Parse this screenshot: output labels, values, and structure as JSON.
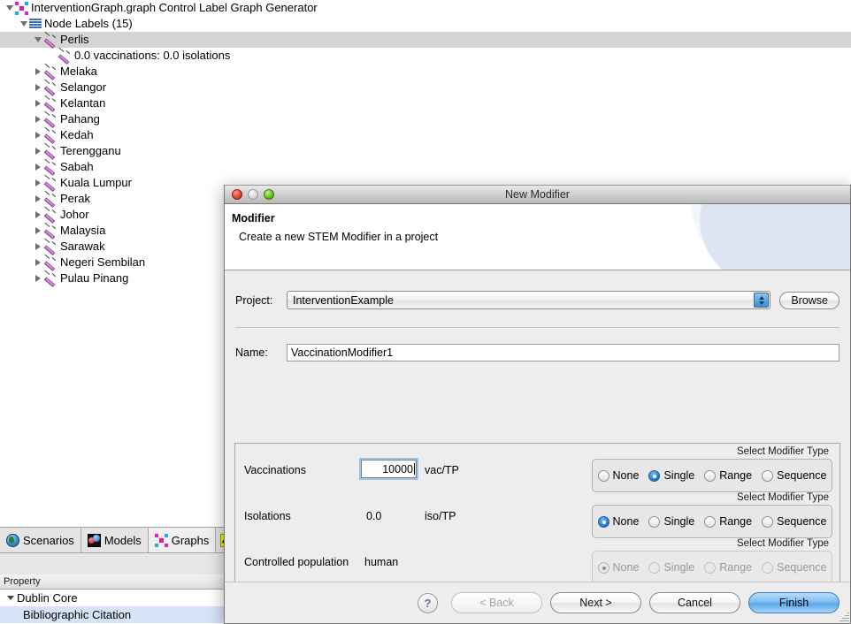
{
  "workbench": {
    "tree": {
      "root": {
        "label": "InterventionGraph.graph Control Label Graph Generator",
        "icon": "graph-icon",
        "expanded": true
      },
      "group": {
        "label": "Node Labels (15)",
        "icon": "node-labels-icon",
        "expanded": true
      },
      "selected_node": {
        "label": "Perlis",
        "icon": "syringe-icon",
        "expanded": true
      },
      "selected_child": {
        "label": "0.0 vaccinations: 0.0 isolations",
        "icon": "syringe-icon"
      },
      "nodes": [
        {
          "label": "Melaka",
          "icon": "syringe-icon"
        },
        {
          "label": "Selangor",
          "icon": "syringe-icon"
        },
        {
          "label": "Kelantan",
          "icon": "syringe-icon"
        },
        {
          "label": "Pahang",
          "icon": "syringe-icon"
        },
        {
          "label": "Kedah",
          "icon": "syringe-icon"
        },
        {
          "label": "Terengganu",
          "icon": "syringe-icon"
        },
        {
          "label": "Sabah",
          "icon": "syringe-icon"
        },
        {
          "label": "Kuala Lumpur",
          "icon": "syringe-icon"
        },
        {
          "label": "Perak",
          "icon": "syringe-icon"
        },
        {
          "label": "Johor",
          "icon": "syringe-icon"
        },
        {
          "label": "Malaysia",
          "icon": "syringe-icon"
        },
        {
          "label": "Sarawak",
          "icon": "syringe-icon"
        },
        {
          "label": "Negeri Sembilan",
          "icon": "syringe-icon"
        },
        {
          "label": "Pulau Pinang",
          "icon": "syringe-icon"
        }
      ]
    },
    "tabs": [
      {
        "label": "Scenarios",
        "icon": "globe-icon",
        "active": false
      },
      {
        "label": "Models",
        "icon": "models-icon",
        "active": false
      },
      {
        "label": "Graphs",
        "icon": "graph-icon",
        "active": true
      },
      {
        "label": "",
        "icon": "yellow-edge-icon",
        "active": false
      }
    ],
    "properties": {
      "header": "Property",
      "rows": [
        {
          "label": "Dublin Core",
          "expanded": true,
          "highlighted": false
        },
        {
          "label": "Bibliographic Citation",
          "expanded": false,
          "highlighted": true
        }
      ]
    }
  },
  "dialog": {
    "title": "New Modifier",
    "banner": {
      "heading": "Modifier",
      "subheading": "Create a new STEM Modifier in a project"
    },
    "project": {
      "label": "Project:",
      "value": "InterventionExample",
      "browse_label": "Browse"
    },
    "name": {
      "label": "Name:",
      "value": "VaccinationModifier1"
    },
    "params": [
      {
        "name": "Vaccinations",
        "value": "10000",
        "unit": "vac/TP",
        "editable": true,
        "focused": true,
        "group_caption": "Select Modifier Type",
        "options": [
          "None",
          "Single",
          "Range",
          "Sequence"
        ],
        "selected": "Single",
        "enabled": true
      },
      {
        "name": "Isolations",
        "value": "0.0",
        "unit": "iso/TP",
        "editable": false,
        "focused": false,
        "group_caption": "Select Modifier Type",
        "options": [
          "None",
          "Single",
          "Range",
          "Sequence"
        ],
        "selected": "None",
        "enabled": true
      },
      {
        "name": "Controlled population",
        "value": "human",
        "unit": "",
        "editable": false,
        "focused": false,
        "group_caption": "Select Modifier Type",
        "options": [
          "None",
          "Single",
          "Range",
          "Sequence"
        ],
        "selected": "None",
        "enabled": false
      }
    ],
    "footer": {
      "help_label": "?",
      "back_label": "< Back",
      "next_label": "Next >",
      "cancel_label": "Cancel",
      "finish_label": "Finish"
    }
  },
  "colors": {
    "accent": "#2b7ed1",
    "selection_tree": "#d4d4d4",
    "selection_property": "#d7e4f7",
    "dialog_bg": "#ededed"
  }
}
